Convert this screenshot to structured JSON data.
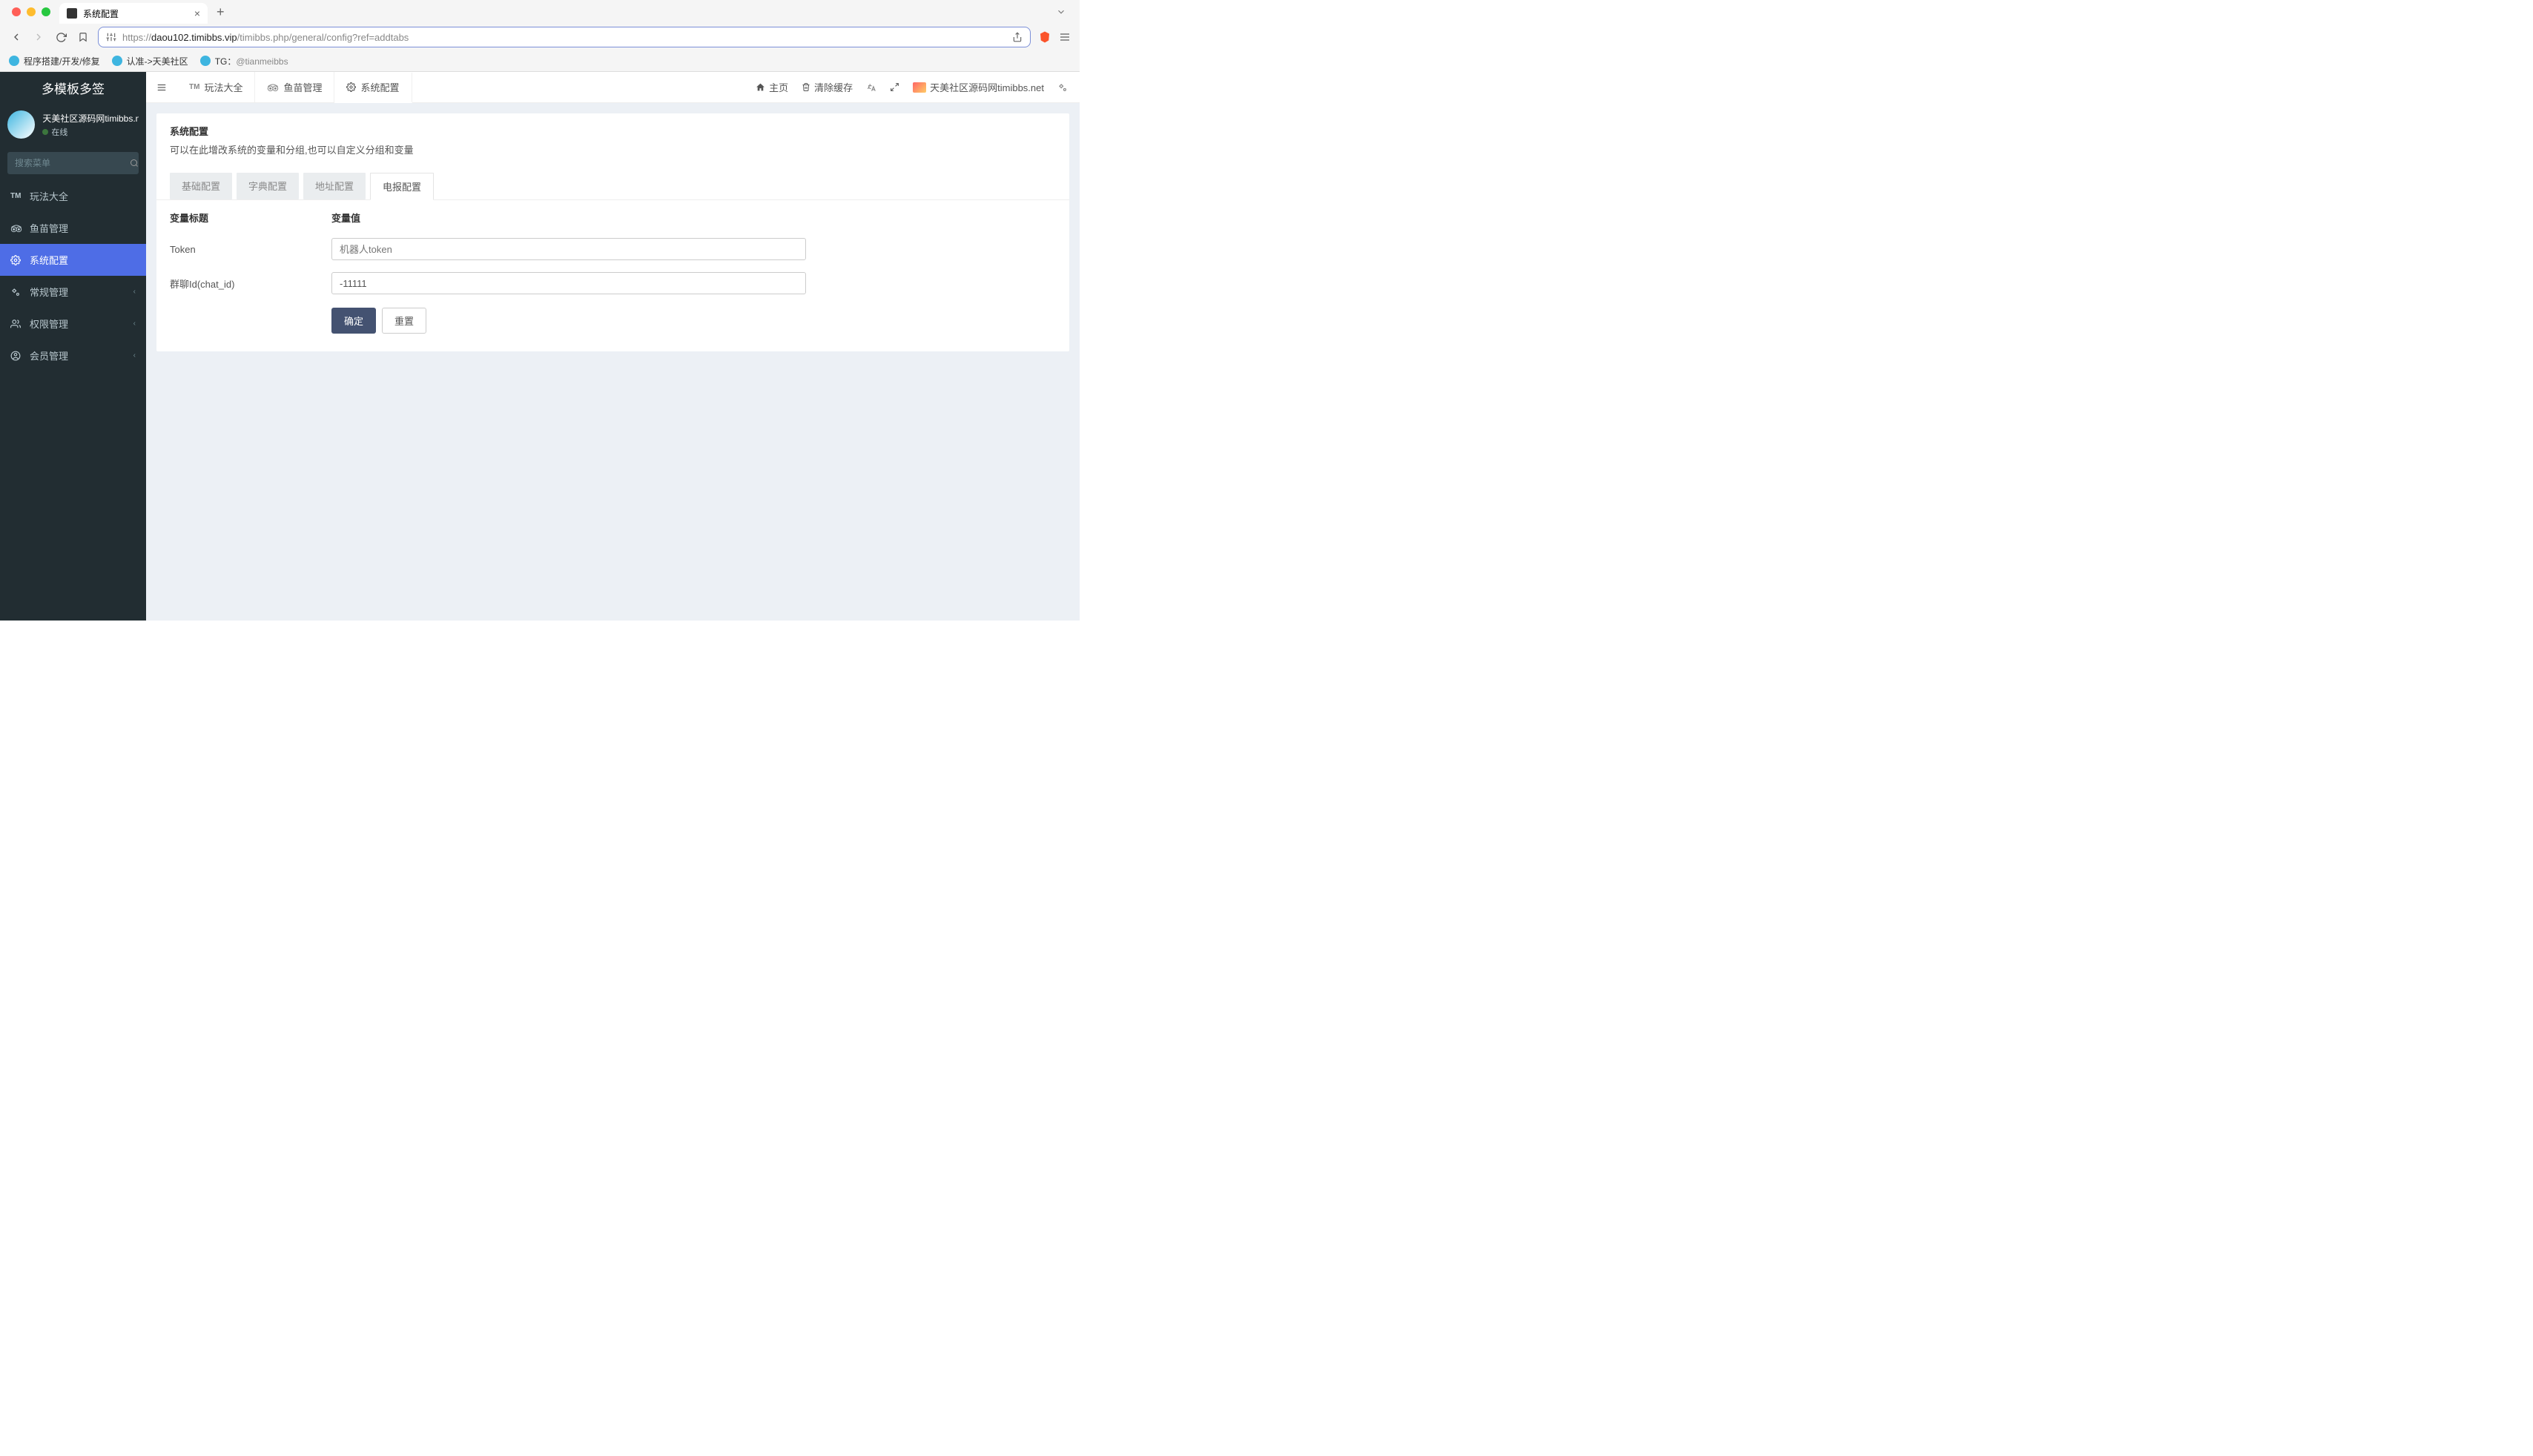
{
  "browser": {
    "tab_title": "系统配置",
    "url_prefix": "https://",
    "url_domain": "daou102.timibbs.vip",
    "url_path": "/timibbs.php/general/config?ref=addtabs",
    "bookmarks": [
      {
        "label": "程序搭建/开发/修复"
      },
      {
        "label": "认准->天美社区"
      },
      {
        "label_prefix": "TG：",
        "label_handle": "@tianmeibbs"
      }
    ]
  },
  "sidebar": {
    "brand": "多模板多签",
    "user_name": "天美社区源码网timibbs.n",
    "user_status": "在线",
    "search_placeholder": "搜索菜单",
    "menu": [
      {
        "icon": "TM",
        "label": "玩法大全"
      },
      {
        "icon": "👁",
        "label": "鱼苗管理"
      },
      {
        "icon": "⚙",
        "label": "系统配置",
        "active": true
      },
      {
        "icon": "⚙",
        "label": "常规管理",
        "has_children": true
      },
      {
        "icon": "👥",
        "label": "权限管理",
        "has_children": true
      },
      {
        "icon": "👤",
        "label": "会员管理",
        "has_children": true
      }
    ]
  },
  "top_nav": {
    "tabs": [
      {
        "icon": "TM",
        "label": "玩法大全"
      },
      {
        "icon": "👁",
        "label": "鱼苗管理"
      },
      {
        "icon": "⚙",
        "label": "系统配置",
        "active": true
      }
    ],
    "right": {
      "home": "主页",
      "clear_cache": "清除缓存",
      "site_name": "天美社区源码网timibbs.net"
    }
  },
  "panel": {
    "title": "系统配置",
    "desc": "可以在此增改系统的变量和分组,也可以自定义分组和变量",
    "tabs": [
      {
        "label": "基础配置"
      },
      {
        "label": "字典配置"
      },
      {
        "label": "地址配置"
      },
      {
        "label": "电报配置",
        "active": true
      }
    ],
    "header_label": "变量标题",
    "header_value": "变量值",
    "rows": [
      {
        "label": "Token",
        "placeholder": "机器人token",
        "value": ""
      },
      {
        "label": "群聊Id(chat_id)",
        "placeholder": "",
        "value": "-11111"
      }
    ],
    "submit": "确定",
    "reset": "重置"
  }
}
